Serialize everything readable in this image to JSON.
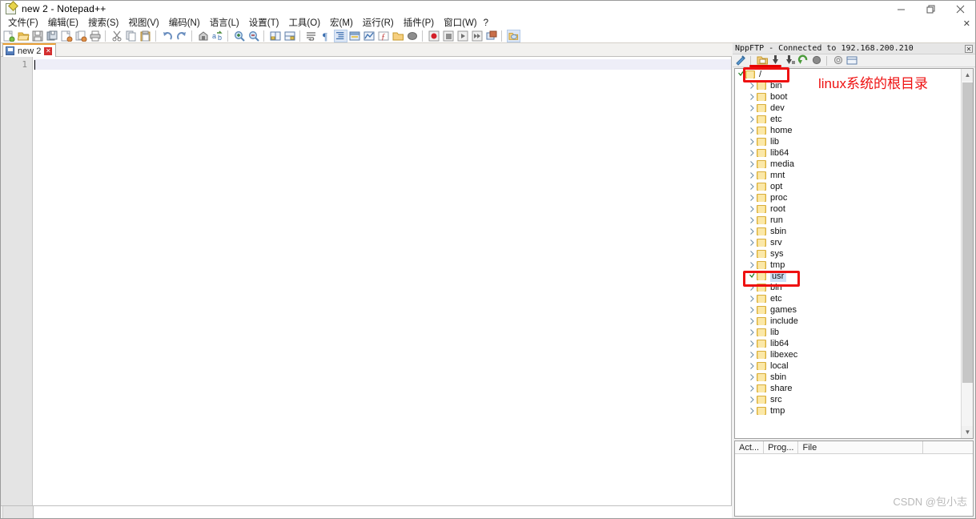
{
  "window": {
    "title": "new 2 - Notepad++",
    "app_icon": "notepad-plus-plus-icon",
    "controls": {
      "minimize": "minimize-icon",
      "maximize": "maximize-icon",
      "close": "close-icon"
    }
  },
  "menu": {
    "items": [
      "文件(F)",
      "编辑(E)",
      "搜索(S)",
      "视图(V)",
      "编码(N)",
      "语言(L)",
      "设置(T)",
      "工具(O)",
      "宏(M)",
      "运行(R)",
      "插件(P)",
      "窗口(W)",
      "?"
    ],
    "close_doc": "✕"
  },
  "toolbar": {
    "groups": [
      [
        "new-file-icon",
        "open-file-icon",
        "save-icon",
        "save-all-icon",
        "close-file-icon",
        "close-all-icon",
        "print-icon"
      ],
      [
        "cut-icon",
        "copy-icon",
        "paste-icon"
      ],
      [
        "undo-icon",
        "redo-icon"
      ],
      [
        "find-icon",
        "replace-icon"
      ],
      [
        "zoom-in-icon",
        "zoom-out-icon"
      ],
      [
        "sync-vertical-icon",
        "sync-horizontal-icon"
      ],
      [
        "word-wrap-icon",
        "show-all-chars-icon"
      ],
      [
        "indent-guide-icon",
        "user-defined-dialog-icon",
        "show-doc-map-icon",
        "function-list-icon",
        "folder-as-workspace-icon",
        "dark-mode-icon"
      ],
      [
        "record-macro-icon",
        "stop-macro-icon",
        "play-macro-icon",
        "play-multiple-icon",
        "save-macro-icon"
      ],
      [
        "nppftp-icon"
      ]
    ]
  },
  "tabs": [
    {
      "label": "new 2",
      "icon": "document-icon",
      "close": "✕",
      "active": true
    }
  ],
  "editor": {
    "line_numbers": [
      "1"
    ],
    "content": ""
  },
  "ftp_panel": {
    "title": "NppFTP - Connected to 192.168.200.210",
    "close_button": "✕",
    "toolbar": [
      "connect-icon",
      "open-directory-icon",
      "download-icon",
      "download-other-icon",
      "refresh-icon",
      "abort-icon",
      "settings-icon",
      "messages-icon"
    ],
    "tree": {
      "root": {
        "label": "/",
        "expanded": true,
        "icon": "folder-icon"
      },
      "children": [
        {
          "label": "bin",
          "expanded": false
        },
        {
          "label": "boot",
          "expanded": false
        },
        {
          "label": "dev",
          "expanded": false
        },
        {
          "label": "etc",
          "expanded": false
        },
        {
          "label": "home",
          "expanded": false
        },
        {
          "label": "lib",
          "expanded": false
        },
        {
          "label": "lib64",
          "expanded": false
        },
        {
          "label": "media",
          "expanded": false
        },
        {
          "label": "mnt",
          "expanded": false
        },
        {
          "label": "opt",
          "expanded": false
        },
        {
          "label": "proc",
          "expanded": false
        },
        {
          "label": "root",
          "expanded": false
        },
        {
          "label": "run",
          "expanded": false
        },
        {
          "label": "sbin",
          "expanded": false
        },
        {
          "label": "srv",
          "expanded": false
        },
        {
          "label": "sys",
          "expanded": false
        },
        {
          "label": "tmp",
          "expanded": false
        },
        {
          "label": "usr",
          "expanded": true,
          "selected": true
        },
        {
          "label": "bin",
          "depth": 2
        },
        {
          "label": "etc",
          "depth": 2
        },
        {
          "label": "games",
          "depth": 2
        },
        {
          "label": "include",
          "depth": 2
        },
        {
          "label": "lib",
          "depth": 2
        },
        {
          "label": "lib64",
          "depth": 2
        },
        {
          "label": "libexec",
          "depth": 2
        },
        {
          "label": "local",
          "depth": 2
        },
        {
          "label": "sbin",
          "depth": 2
        },
        {
          "label": "share",
          "depth": 2
        },
        {
          "label": "src",
          "depth": 2
        },
        {
          "label": "tmp",
          "depth": 2
        }
      ]
    },
    "log": {
      "columns": [
        "Act...",
        "Prog...",
        "File"
      ],
      "rows": []
    },
    "scrollbar": {
      "up": "▲",
      "down": "▼"
    }
  },
  "annotations": {
    "root_note": "linux系统的根目录",
    "boxes": [
      "root-row-box",
      "usr-row-box",
      "toolbar-underline"
    ],
    "accent_color": "#ee1111"
  },
  "watermark": "CSDN @包小志"
}
